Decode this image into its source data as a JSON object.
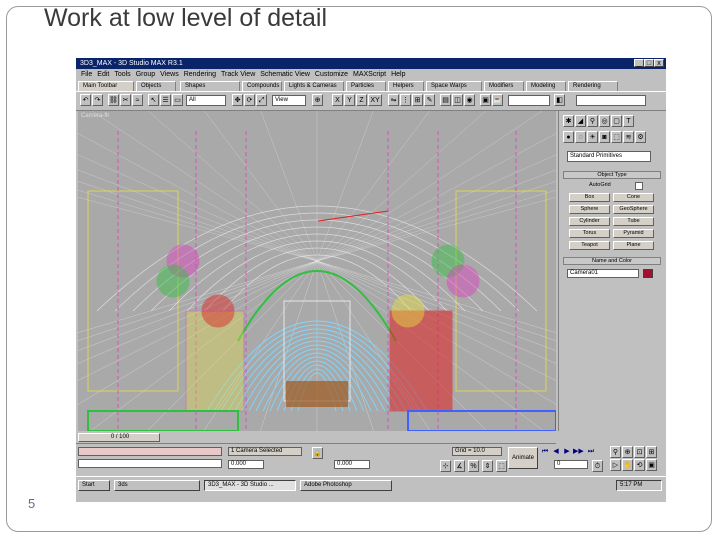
{
  "slide": {
    "title": "Work at low level of detail",
    "page_number": "5"
  },
  "window": {
    "title": "3D3_MAX - 3D Studio MAX R3.1",
    "minimize": "_",
    "maximize": "□",
    "close": "x"
  },
  "menu": [
    "File",
    "Edit",
    "Tools",
    "Group",
    "Views",
    "Rendering",
    "Track View",
    "Schematic View",
    "Customize",
    "MAXScript",
    "Help"
  ],
  "tabs": [
    "Main Toolbar",
    "Objects",
    "Shapes",
    "Compounds",
    "Lights & Cameras",
    "Particles",
    "Helpers",
    "Space Warps",
    "Modifiers",
    "Modeling",
    "Rendering"
  ],
  "toolbar": {
    "selection_filter": "All",
    "ref_coord": "View",
    "axis_x": "X",
    "axis_y": "Y",
    "axis_z": "Z",
    "axis_xy": "XY"
  },
  "viewport": {
    "label": "Camera-flr"
  },
  "command_panel": {
    "category": "Standard Primitives",
    "object_type_header": "Object Type",
    "autogrid": "AutoGrid",
    "buttons": [
      "Box",
      "Cone",
      "Sphere",
      "GeoSphere",
      "Cylinder",
      "Tube",
      "Torus",
      "Pyramid",
      "Teapot",
      "Plane"
    ],
    "name_color_header": "Name and Color",
    "name_value": "Camera01"
  },
  "status": {
    "time_slider": "0 / 100",
    "selected": "1 Camera Selected",
    "coord_x": "0.000",
    "coord_z": "0.000",
    "grid": "Grid = 10.0",
    "animate": "Animate",
    "frame": "0"
  },
  "taskbar": {
    "start": "Start",
    "tasks": [
      "3ds",
      "3D3_MAX - 3D Studio ...",
      "Adobe Photoshop"
    ],
    "clock": "5:17 PM"
  },
  "colors": {
    "titlebar": "#0a246a",
    "viewport_bg": "#a9a9a9",
    "ui_gray": "#c0c0c0",
    "wire_cyan": "#7fd7ff",
    "wire_red": "#e02020",
    "wire_yellow": "#e8e040",
    "wire_green": "#30c040",
    "wire_magenta": "#e040c0",
    "wire_blue": "#4060ff",
    "wire_white": "#e8e8e8"
  }
}
